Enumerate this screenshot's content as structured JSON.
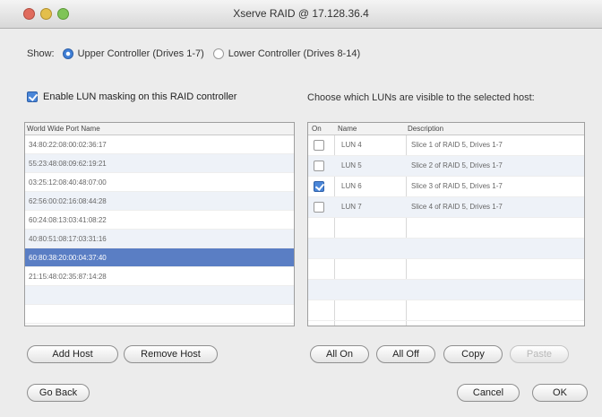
{
  "window": {
    "title": "Xserve RAID @ 17.128.36.4"
  },
  "show": {
    "label": "Show:",
    "upper": "Upper Controller (Drives 1-7)",
    "lower": "Lower Controller (Drives 8-14)",
    "selected": "upper"
  },
  "enable_masking": {
    "label": "Enable LUN masking on this RAID controller",
    "checked": true
  },
  "choose_label": "Choose which LUNs are visible to the selected host:",
  "wwpn_table": {
    "header": "World Wide Port Name",
    "rows": [
      "34:80:22:08:00:02:36:17",
      "55:23:48:08:09:62:19:21",
      "03:25:12:08:40:48:07:00",
      "62:56:00:02:16:08:44:28",
      "60:24:08:13:03:41:08:22",
      "40:80:51:08:17:03:31:16",
      "60:80:38:20:00:04:37:40",
      "21:15:48:02:35:87:14:28"
    ],
    "selected_index": 6
  },
  "lun_table": {
    "headers": {
      "on": "On",
      "name": "Name",
      "description": "Description"
    },
    "rows": [
      {
        "on": false,
        "name": "LUN 4",
        "description": "Slice 1 of RAID 5, Drives 1-7"
      },
      {
        "on": false,
        "name": "LUN 5",
        "description": "Slice 2 of RAID 5, Drives 1-7"
      },
      {
        "on": true,
        "name": "LUN 6",
        "description": "Slice 3 of RAID 5, Drives 1-7"
      },
      {
        "on": false,
        "name": "LUN 7",
        "description": "Slice 4 of RAID 5, Drives 1-7"
      }
    ]
  },
  "buttons": {
    "add_host": "Add Host",
    "remove_host": "Remove Host",
    "all_on": "All On",
    "all_off": "All Off",
    "copy": "Copy",
    "paste": "Paste",
    "go_back": "Go Back",
    "cancel": "Cancel",
    "ok": "OK"
  }
}
